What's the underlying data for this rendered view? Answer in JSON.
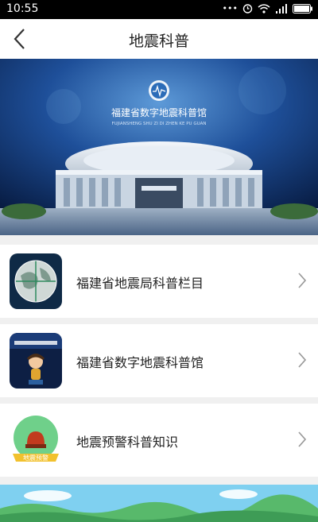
{
  "status": {
    "time": "10:55"
  },
  "nav": {
    "title": "地震科普"
  },
  "banner": {
    "title_cn": "福建省数字地震科普馆",
    "title_pinyin": "FUJIANSHENG SHU ZI DI ZHEN KE PU GUAN"
  },
  "items": [
    {
      "label": "福建省地震局科普栏目",
      "icon": "globe-icon"
    },
    {
      "label": "福建省数字地震科普馆",
      "icon": "museum-mascot-icon"
    },
    {
      "label": "地震预警科普知识",
      "icon": "warning-alarm-icon",
      "badge": "地震预警"
    }
  ]
}
